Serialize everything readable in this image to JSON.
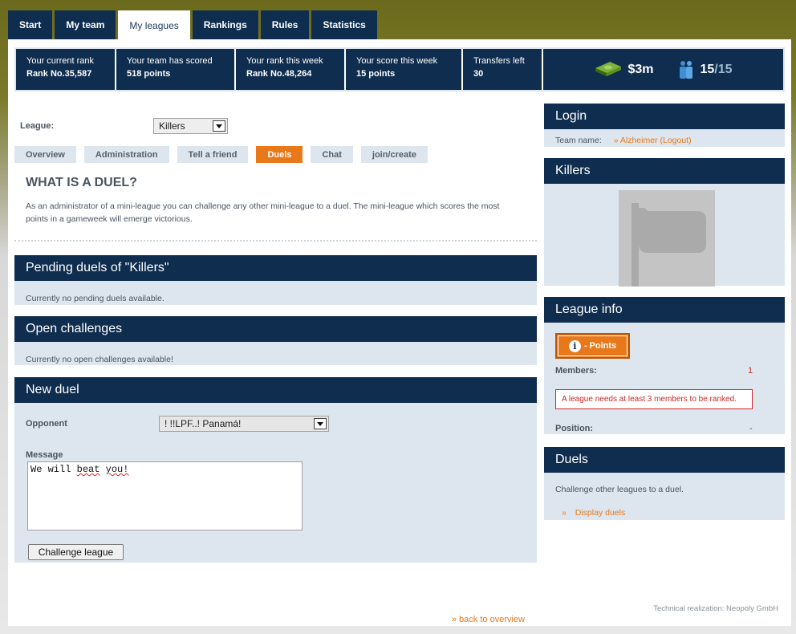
{
  "topnav": {
    "tabs": [
      {
        "label": "Start"
      },
      {
        "label": "My team"
      },
      {
        "label": "My leagues",
        "active": true
      },
      {
        "label": "Rankings"
      },
      {
        "label": "Rules"
      },
      {
        "label": "Statistics"
      }
    ]
  },
  "stats": {
    "current_rank_label": "Your current rank",
    "current_rank_value": "Rank No.35,587",
    "scored_label": "Your team has scored",
    "scored_value": "518 points",
    "week_rank_label": "Your rank this week",
    "week_rank_value": "Rank No.48,264",
    "week_score_label": "Your score this week",
    "week_score_value": "15 points",
    "transfers_label": "Transfers left",
    "transfers_value": "30",
    "money": "$3m",
    "players_current": "15",
    "players_total": "/15",
    "icons": {
      "money": "money-stack-icon",
      "players": "players-icon"
    }
  },
  "league": {
    "label": "League:",
    "selected": "Killers"
  },
  "subtabs": [
    {
      "label": "Overview"
    },
    {
      "label": "Administration"
    },
    {
      "label": "Tell a friend"
    },
    {
      "label": "Duels",
      "active": true
    },
    {
      "label": "Chat"
    },
    {
      "label": "join/create"
    }
  ],
  "duel_intro": {
    "title": "WHAT IS A DUEL?",
    "text": "As an administrator of a mini-league you can challenge any other mini-league to a duel. The mini-league which scores the most points in a gameweek will emerge victorious."
  },
  "pending": {
    "title": "Pending duels of \"Killers\"",
    "text": "Currently no pending duels available."
  },
  "open_challenges": {
    "title": "Open challenges",
    "text": "Currently no open challenges available!"
  },
  "new_duel": {
    "title": "New duel",
    "opponent_label": "Opponent",
    "opponent_value": "! !!LPF..! Panamá!",
    "message_label": "Message",
    "message_words": [
      "We",
      "will",
      "beat",
      "you!"
    ],
    "button": "Challenge league"
  },
  "back_link": "» back to overview",
  "tech": "Technical realization: Neopoly GmbH",
  "login": {
    "title": "Login",
    "team_label": "Team name:",
    "team_value": "» Alzheimer (Logout)"
  },
  "league_box": {
    "title": "Killers"
  },
  "league_info": {
    "title": "League info",
    "points_button": "- Points",
    "members_label": "Members:",
    "members_value": "1",
    "warning": "A league needs at least 3 members to be ranked.",
    "position_label": "Position:",
    "position_value": "-"
  },
  "duels_box": {
    "title": "Duels",
    "text": "Challenge other leagues to a duel.",
    "link_arrow": "»",
    "link": "Display duels"
  },
  "colors": {
    "navy": "#0f2d4f",
    "orange": "#e8781a",
    "panel": "#dde6ee",
    "warning": "#cc2a2a"
  }
}
